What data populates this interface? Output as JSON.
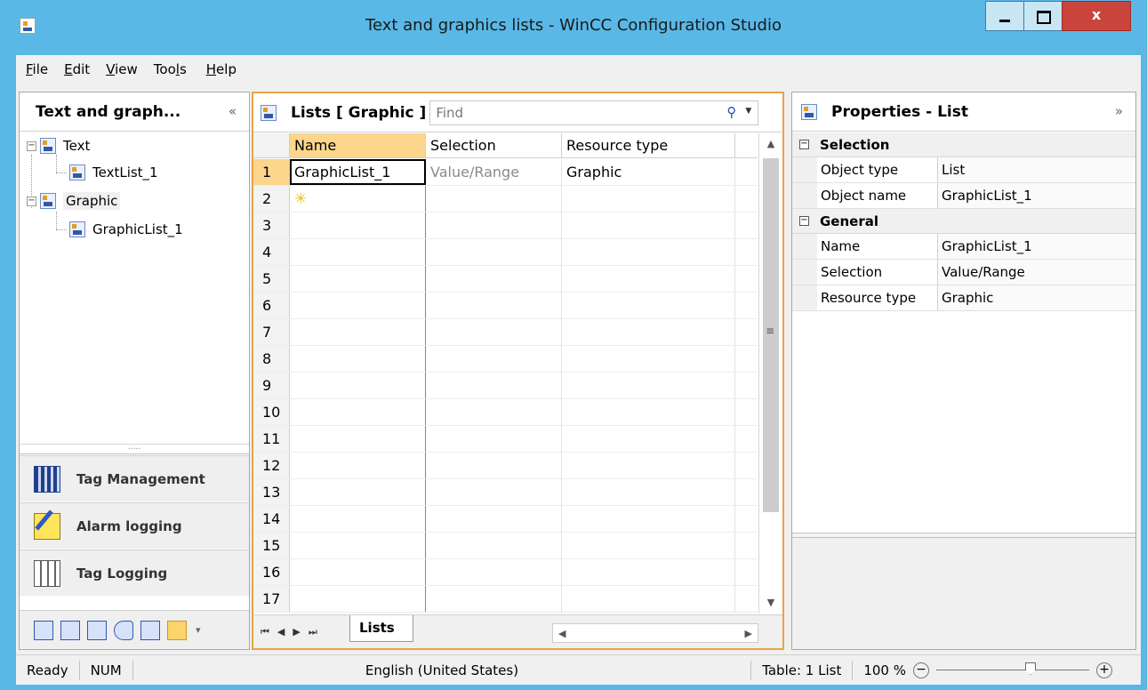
{
  "window": {
    "title": "Text and graphics lists - WinCC Configuration Studio",
    "close_label": "x"
  },
  "menu": [
    {
      "label": "File",
      "key": "F",
      "rest": "ile"
    },
    {
      "label": "Edit",
      "key": "E",
      "rest": "dit"
    },
    {
      "label": "View",
      "key": "V",
      "rest": "iew"
    },
    {
      "label": "Tools",
      "pre": "Too",
      "key": "l",
      "rest": "s"
    },
    {
      "label": "Help",
      "key": "H",
      "rest": "elp"
    }
  ],
  "left_panel": {
    "title": "Text and graph...",
    "collapse_label": "«",
    "tree": [
      {
        "label": "Text",
        "expander": "−"
      },
      {
        "label": "TextList_1"
      },
      {
        "label": "Graphic",
        "expander": "−"
      },
      {
        "label": "GraphicList_1"
      }
    ],
    "splitter_grip": ".....",
    "nav_buttons": [
      {
        "label": "Tag Management",
        "icon": "tag-management-icon"
      },
      {
        "label": "Alarm logging",
        "icon": "alarm-logging-icon"
      },
      {
        "label": "Tag Logging",
        "icon": "tag-logging-icon"
      }
    ],
    "more_label": "▾"
  },
  "center_panel": {
    "title": "Lists [ Graphic ]",
    "find_placeholder": "Find",
    "columns": [
      "Name",
      "Selection",
      "Resource type"
    ],
    "rows": [
      {
        "num": "1",
        "name": "GraphicList_1",
        "selection": "Value/Range",
        "resource_type": "Graphic"
      },
      {
        "num": "2",
        "name": "",
        "selection": "",
        "resource_type": ""
      },
      {
        "num": "3"
      },
      {
        "num": "4"
      },
      {
        "num": "5"
      },
      {
        "num": "6"
      },
      {
        "num": "7"
      },
      {
        "num": "8"
      },
      {
        "num": "9"
      },
      {
        "num": "10"
      },
      {
        "num": "11"
      },
      {
        "num": "12"
      },
      {
        "num": "13"
      },
      {
        "num": "14"
      },
      {
        "num": "15"
      },
      {
        "num": "16"
      },
      {
        "num": "17"
      }
    ],
    "sheet_tab": "Lists",
    "nav_arrows": [
      "⏮",
      "◀",
      "▶",
      "⏭"
    ]
  },
  "right_panel": {
    "title": "Properties - List",
    "expand_label": "»",
    "categories": [
      {
        "name": "Selection",
        "props": [
          {
            "name": "Object type",
            "value": "List"
          },
          {
            "name": "Object name",
            "value": "GraphicList_1"
          }
        ]
      },
      {
        "name": "General",
        "props": [
          {
            "name": "Name",
            "value": "GraphicList_1"
          },
          {
            "name": "Selection",
            "value": "Value/Range"
          },
          {
            "name": "Resource type",
            "value": "Graphic"
          }
        ]
      }
    ]
  },
  "status": {
    "ready": "Ready",
    "num": "NUM",
    "language": "English (United States)",
    "table": "Table: 1 List",
    "zoom": "100 %",
    "zoom_minus": "−",
    "zoom_plus": "+"
  }
}
